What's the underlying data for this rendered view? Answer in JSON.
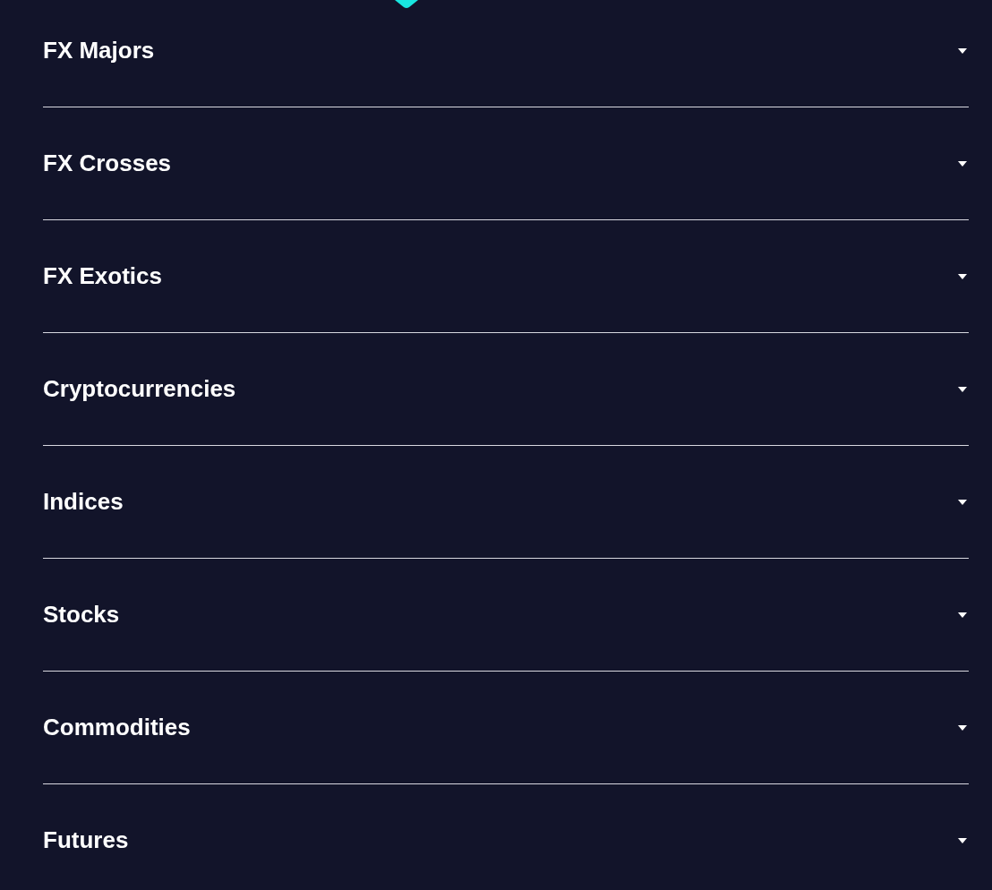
{
  "sections": [
    {
      "label": "FX Majors",
      "expanded": false
    },
    {
      "label": "FX Crosses",
      "expanded": false
    },
    {
      "label": "FX Exotics",
      "expanded": false
    },
    {
      "label": "Cryptocurrencies",
      "expanded": false
    },
    {
      "label": "Indices",
      "expanded": false
    },
    {
      "label": "Stocks",
      "expanded": false
    },
    {
      "label": "Commodities",
      "expanded": false
    },
    {
      "label": "Futures",
      "expanded": false
    }
  ]
}
